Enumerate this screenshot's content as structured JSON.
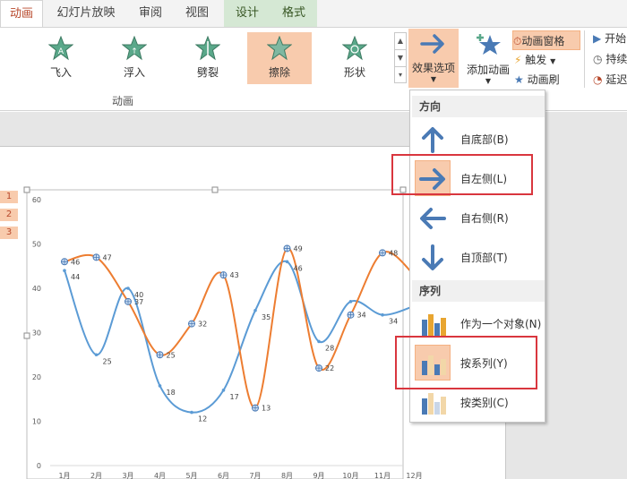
{
  "tabs": [
    {
      "label": "动画",
      "active": true
    },
    {
      "label": "幻灯片放映"
    },
    {
      "label": "审阅"
    },
    {
      "label": "视图"
    },
    {
      "label": "设计",
      "contextual": true
    },
    {
      "label": "格式",
      "contextual": true
    }
  ],
  "gallery": {
    "items": [
      {
        "label": "飞入"
      },
      {
        "label": "浮入"
      },
      {
        "label": "劈裂"
      },
      {
        "label": "擦除",
        "selected": true
      },
      {
        "label": "形状"
      }
    ],
    "group_label": "动画"
  },
  "effect_options": {
    "label": "效果选项"
  },
  "add_animation": {
    "label": "添加动画"
  },
  "side_commands": {
    "pane": "动画窗格",
    "trigger": "触发",
    "painter": "动画刷",
    "start": "开始",
    "duration": "持续",
    "delay": "延迟"
  },
  "dropdown": {
    "direction_header": "方向",
    "directions": [
      {
        "label": "自底部(B)",
        "icon": "arrow-up-icon"
      },
      {
        "label": "自左侧(L)",
        "icon": "arrow-right-icon",
        "highlighted": true
      },
      {
        "label": "自右侧(R)",
        "icon": "arrow-left-icon"
      },
      {
        "label": "自顶部(T)",
        "icon": "arrow-down-icon"
      }
    ],
    "sequence_header": "序列",
    "sequences": [
      {
        "label": "作为一个对象(N)",
        "icon": "bar-chart-single-icon"
      },
      {
        "label": "按系列(Y)",
        "icon": "bar-chart-series-icon",
        "highlighted": true
      },
      {
        "label": "按类别(C)",
        "icon": "bar-chart-category-icon"
      }
    ]
  },
  "slide_markers": [
    "1",
    "2",
    "3"
  ],
  "colors": {
    "accent": "#b7472a",
    "selection": "#f8cbad",
    "blue_series": "#5b9bd5",
    "orange_series": "#ed7d31",
    "red_highlight": "#d9363e",
    "arrow_blue": "#4a7ab5"
  },
  "chart_data": {
    "type": "line",
    "categories": [
      "1月",
      "2月",
      "3月",
      "4月",
      "5月",
      "6月",
      "7月",
      "8月",
      "9月",
      "10月",
      "11月",
      "12月"
    ],
    "series": [
      {
        "values": [
          44,
          25,
          40,
          18,
          12,
          17,
          35,
          46,
          28,
          37,
          34,
          36
        ],
        "color": "#5b9bd5"
      },
      {
        "values": [
          46,
          47,
          37,
          25,
          32,
          43,
          13,
          49,
          22,
          34,
          48,
          43
        ],
        "color": "#ed7d31"
      }
    ],
    "ylim": [
      0,
      60
    ],
    "yticks": [
      0,
      10,
      20,
      30,
      40,
      50,
      60
    ],
    "data_labels_blue": [
      "44",
      "25",
      "40",
      "18",
      "12",
      "17",
      "35",
      "46",
      "28",
      "",
      "34",
      ""
    ],
    "data_labels_orange": [
      "46",
      "47",
      "37",
      "25",
      "32",
      "43",
      "13",
      "49",
      "22",
      "34",
      "48",
      ""
    ],
    "grid": false
  }
}
